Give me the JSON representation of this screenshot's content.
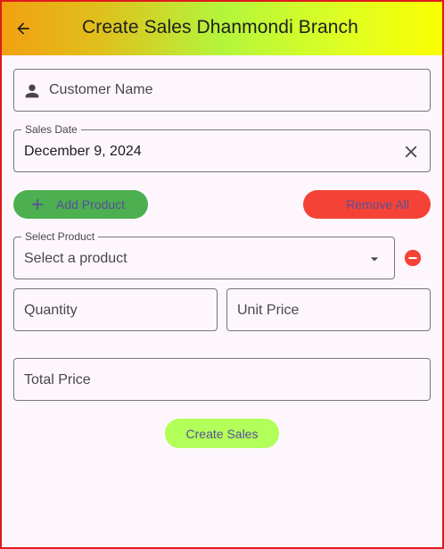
{
  "appbar": {
    "title": "Create Sales Dhanmondi Branch",
    "back_icon": "arrow-back-icon"
  },
  "customer": {
    "label": "Customer Name",
    "icon": "person-icon"
  },
  "sales_date": {
    "label": "Sales Date",
    "value": "December 9, 2024",
    "clear_icon": "close-icon"
  },
  "actions": {
    "add_label": "Add Product",
    "remove_all_label": "Remove All"
  },
  "product": {
    "label": "Select Product",
    "placeholder": "Select a product",
    "remove_icon": "remove-circle-icon"
  },
  "quantity": {
    "label": "Quantity"
  },
  "unit_price": {
    "label": "Unit Price"
  },
  "total_price": {
    "label": "Total Price"
  },
  "submit": {
    "label": "Create Sales"
  },
  "colors": {
    "add_button": "#4caf50",
    "remove_button": "#f44336",
    "submit_button": "#b2ff59",
    "button_text": "#5a4f9a"
  }
}
